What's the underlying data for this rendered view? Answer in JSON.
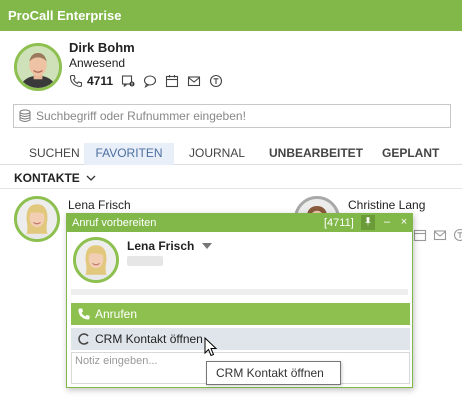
{
  "app": {
    "title": "ProCall Enterprise"
  },
  "profile": {
    "name": "Dirk Bohm",
    "status": "Anwesend",
    "extension": "4711",
    "icons": [
      "phone-icon",
      "voicemail-icon",
      "chat-icon",
      "calendar-icon",
      "mail-icon",
      "settings-icon"
    ]
  },
  "search": {
    "placeholder": "Suchbegriff oder Rufnummer eingeben!"
  },
  "tabs": [
    {
      "label": "SUCHEN"
    },
    {
      "label": "FAVORITEN"
    },
    {
      "label": "JOURNAL"
    },
    {
      "label": "UNBEARBEITET"
    },
    {
      "label": "GEPLANT"
    }
  ],
  "section": {
    "label": "KONTAKTE"
  },
  "contacts": [
    {
      "name": "Lena Frisch"
    },
    {
      "name": "Christine Lang"
    }
  ],
  "popup": {
    "title": "Anruf vorbereiten",
    "extension": "[4711]",
    "pin": "📌",
    "minimize": "–",
    "close": "×",
    "contact_name": "Lena Frisch",
    "call_label": "Anrufen",
    "crm_label": "CRM Kontakt öffnen",
    "note_placeholder": "Notiz eingeben..."
  },
  "tooltip": {
    "text": "CRM Kontakt öffnen"
  },
  "colors": {
    "accent": "#82b84a",
    "active_tab_text": "#4b6ea0",
    "crm_button": "#dfe5ea"
  }
}
